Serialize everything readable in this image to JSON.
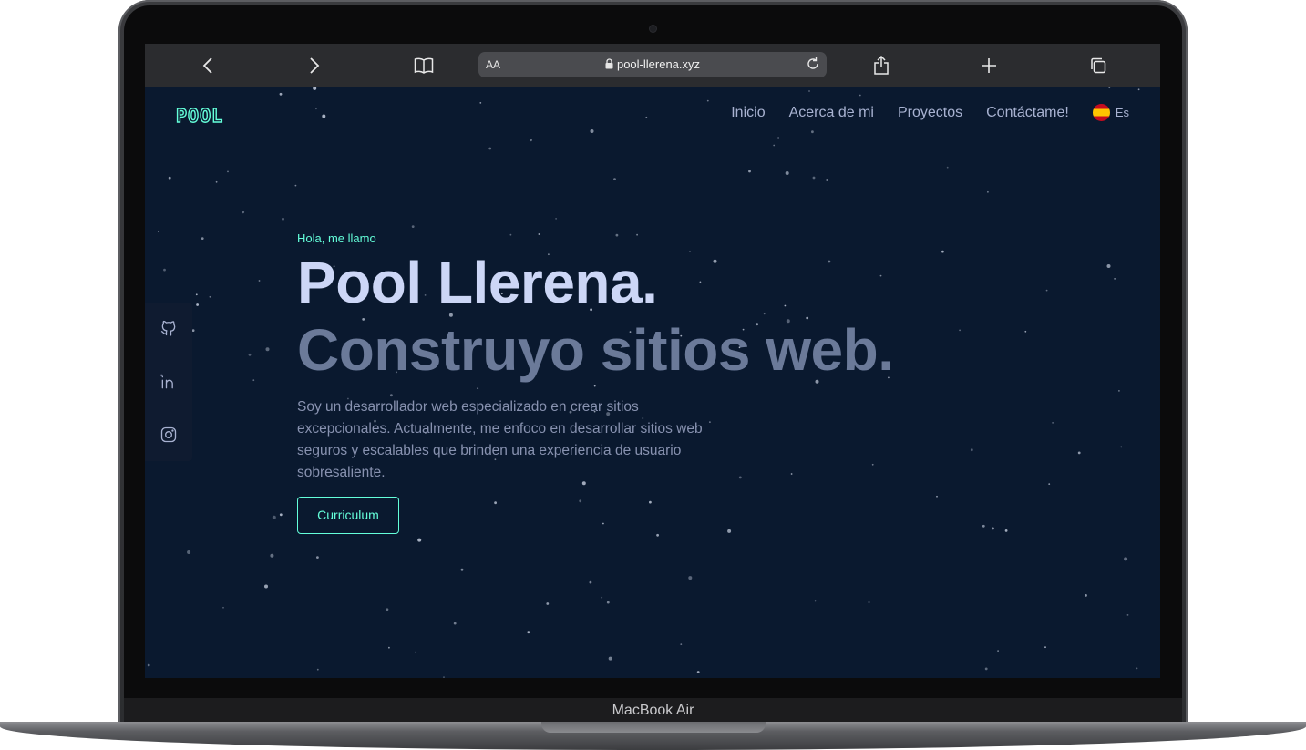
{
  "device": {
    "label": "MacBook Air"
  },
  "browser": {
    "text_size_label": "AA",
    "url": "pool-llerena.xyz",
    "icons": {
      "back": "chevron-left-icon",
      "forward": "chevron-right-icon",
      "bookmarks": "book-icon",
      "lock": "lock-icon",
      "reload": "reload-icon",
      "share": "share-icon",
      "new_tab": "plus-icon",
      "tabs": "tabs-icon"
    }
  },
  "site": {
    "logo": "POOL",
    "nav": {
      "items": [
        "Inicio",
        "Acerca de mi",
        "Proyectos",
        "Contáctame!"
      ],
      "language": "Es"
    },
    "social": [
      "github-icon",
      "linkedin-icon",
      "instagram-icon"
    ],
    "hero": {
      "greeting": "Hola, me llamo",
      "name": "Pool Llerena.",
      "tagline": "Construyo sitios web.",
      "description": "Soy un desarrollador web especializado en crear sitios excepcionales. Actualmente, me enfoco en desarrollar sitios web seguros y escalables que brinden una experiencia de usuario sobresaliente.",
      "button": "Curriculum"
    },
    "colors": {
      "background": "#0a192f",
      "accent": "#64ffda",
      "heading": "#ccd6f6",
      "subheading": "#6b7a99",
      "text": "#8892b0"
    }
  }
}
